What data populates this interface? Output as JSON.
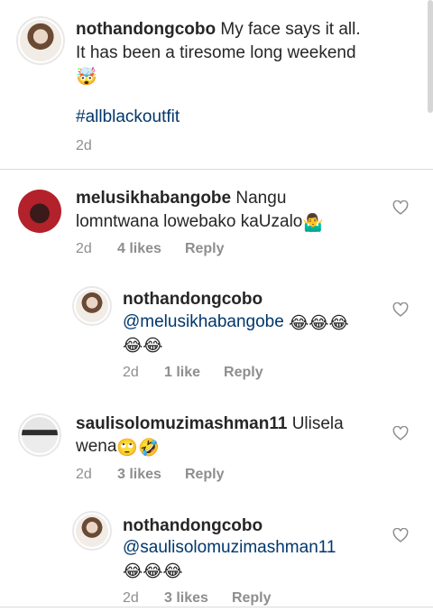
{
  "caption": {
    "username": "nothandongcobo",
    "line1": "My face says it all.",
    "line2": "It has been a tiresome long weekend",
    "emoji": "🤯",
    "hashtag": "#allblackoutfit",
    "date": "2d"
  },
  "comments": [
    {
      "username": "melusikhabangobe",
      "text_part1": "Nangu",
      "text_part2": "lomntwana lowebako kaUzalo",
      "emoji": "🤷‍♂️",
      "date": "2d",
      "likes": "4 likes",
      "reply": "Reply"
    },
    {
      "username": "nothandongcobo",
      "mention": "@melusikhabangobe",
      "emoji_line1": "😂😂😂",
      "emoji_line2": "😂😂",
      "date": "2d",
      "likes": "1 like",
      "reply": "Reply"
    },
    {
      "username": "saulisolomuzimashman11",
      "text_part1": "Ulisela",
      "text_part2": "wena",
      "emoji": "🙄🤣",
      "date": "2d",
      "likes": "3 likes",
      "reply": "Reply"
    },
    {
      "username": "nothandongcobo",
      "mention": "@saulisolomuzimashman11",
      "emoji_line2": "😂😂😂",
      "date": "2d",
      "likes": "3 likes",
      "reply": "Reply"
    }
  ],
  "icons": {
    "heart": "heart-outline-icon"
  },
  "colors": {
    "text": "#262626",
    "secondary": "#8e8e8e",
    "link": "#00376b",
    "divider": "#dbdbdb"
  }
}
